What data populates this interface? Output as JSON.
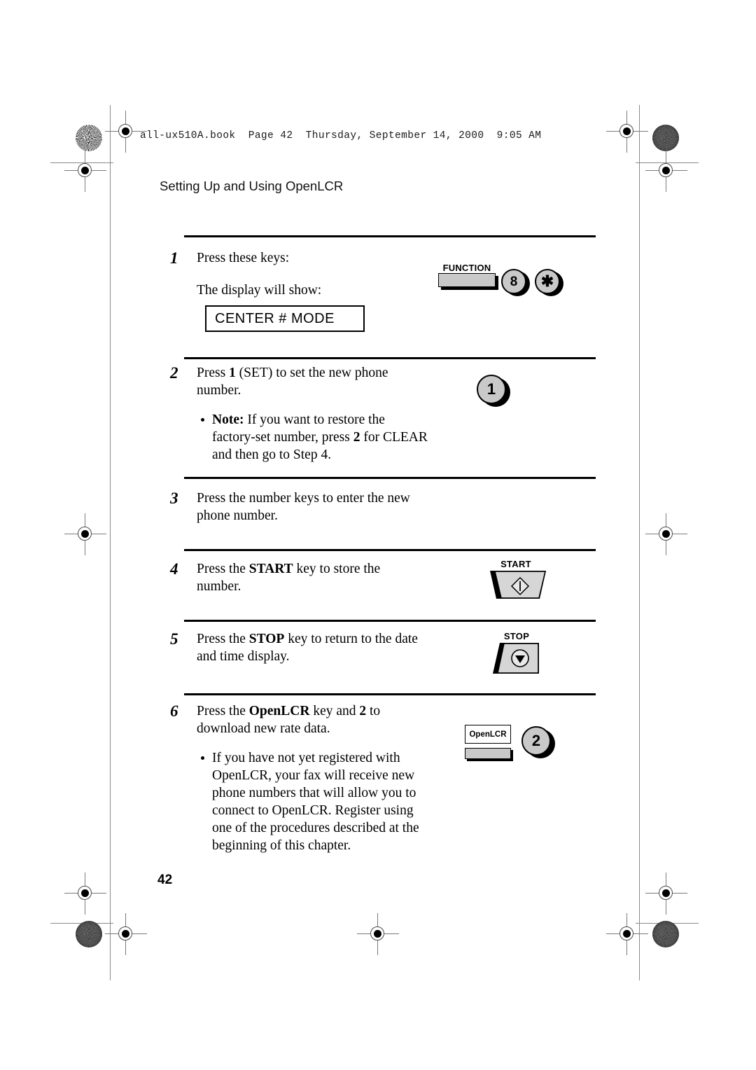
{
  "page": {
    "book_header": "all-ux510A.book  Page 42  Thursday, September 14, 2000  9:05 AM",
    "running_head": "Setting Up and Using OpenLCR",
    "folio": "42"
  },
  "display": {
    "lcd_text": "CENTER # MODE"
  },
  "steps": [
    {
      "num": "1",
      "line1": "Press these keys:",
      "line2": "The display will show:"
    },
    {
      "num": "2",
      "text_a": "Press ",
      "text_b": "1",
      "text_c": " (SET) to set the new phone number.",
      "note_label": "Note:",
      "note_a": " If you want to restore the factory-set number, press ",
      "note_b": "2",
      "note_c": " for CLEAR and then go to Step 4."
    },
    {
      "num": "3",
      "text": "Press the number keys to enter the new phone number."
    },
    {
      "num": "4",
      "text_a": "Press the ",
      "text_b": "START",
      "text_c": " key to store the number."
    },
    {
      "num": "5",
      "text_a": "Press the ",
      "text_b": "STOP",
      "text_c": " key to return to the date and time display."
    },
    {
      "num": "6",
      "text_a": "Press the ",
      "text_b": "OpenLCR",
      "text_c": " key and ",
      "text_d": "2",
      "text_e": " to download new rate data.",
      "bullet": "If you have not yet registered with OpenLCR, your fax will receive new phone numbers that will allow you to connect to OpenLCR. Register using one of the procedures described at the beginning of this chapter."
    }
  ],
  "keys": {
    "function_label": "FUNCTION",
    "key_8": "8",
    "key_asterisk": "✱",
    "key_1": "1",
    "key_2": "2",
    "start_label": "START",
    "stop_label": "STOP",
    "openlcr_label": "OpenLCR"
  },
  "colors": {
    "key_face": "#c9c9c9",
    "ink": "#000000",
    "crop_mark": "#8a8a8a"
  }
}
